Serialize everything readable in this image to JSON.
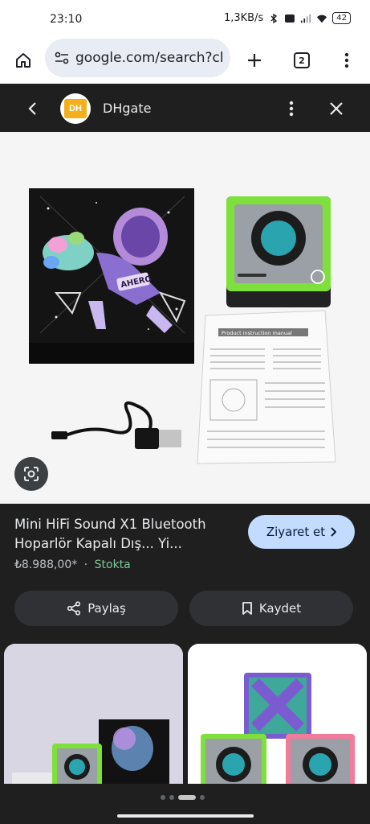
{
  "status": {
    "time": "23:10",
    "network_speed": "1,3KB/s",
    "battery": "42"
  },
  "browser": {
    "url": "google.com/search?cl",
    "tab_count": "2"
  },
  "panel": {
    "site_name": "DHgate",
    "logo_text": "DH"
  },
  "product": {
    "title": "Mini HiFi Sound X1 Bluetooth Hoparlör Kapalı Dış... Yi...",
    "price": "₺8.988,00*",
    "separator": "·",
    "stock": "Stokta",
    "visit_label": "Ziyaret et",
    "share_label": "Paylaş",
    "save_label": "Kaydet"
  },
  "image": {
    "box_print": "AHERO",
    "manual_title": "Product instruction manual"
  },
  "colors": {
    "accent_button": "#c2dbff",
    "stock_green": "#81c995",
    "speaker_green": "#7ee03a"
  }
}
